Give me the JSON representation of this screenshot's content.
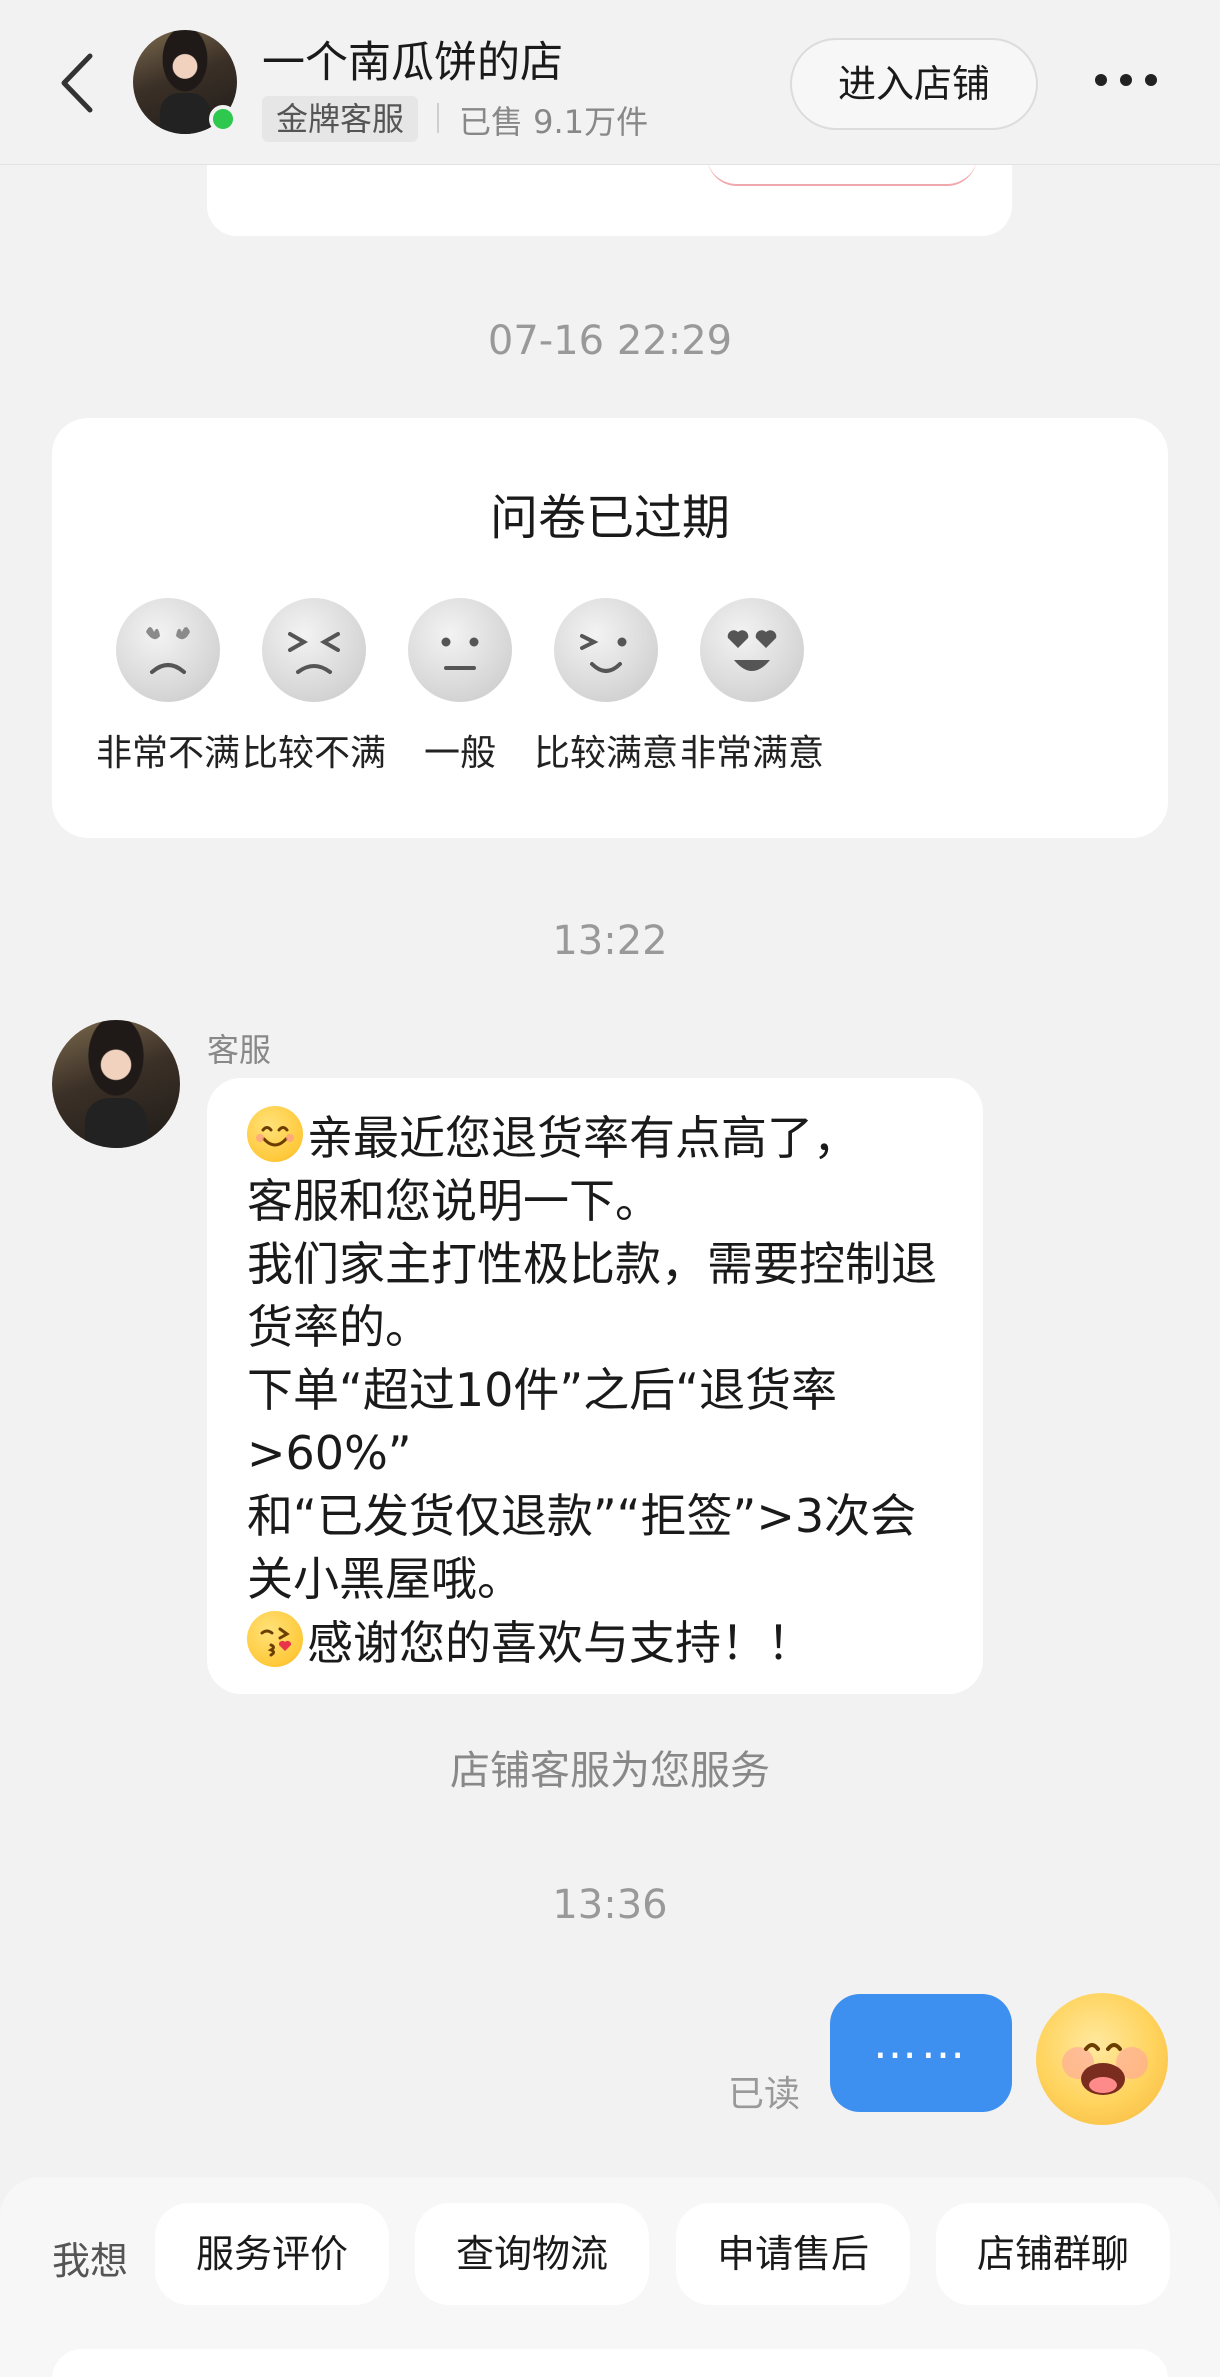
{
  "header": {
    "shop_name": "一个南瓜饼的店",
    "badge": "金牌客服",
    "sold": "已售 9.1万件",
    "enter_shop_label": "进入店铺"
  },
  "timestamps": {
    "t1": "07-16 22:29",
    "t2": "13:22",
    "t3": "13:36"
  },
  "survey": {
    "title": "问卷已过期",
    "options": [
      {
        "label": "非常不满",
        "icon": "very-dissatisfied-face-icon"
      },
      {
        "label": "比较不满",
        "icon": "dissatisfied-face-icon"
      },
      {
        "label": "一般",
        "icon": "neutral-face-icon"
      },
      {
        "label": "比较满意",
        "icon": "satisfied-face-icon"
      },
      {
        "label": "非常满意",
        "icon": "very-satisfied-face-icon"
      }
    ]
  },
  "message_in": {
    "sender": "客服",
    "line1": "亲最近您退货率有点高了，",
    "body": "客服和您说明一下。\n我们家主打性极比款，需要控制退货率的。\n下单“超过10件”之后“退货率>60%”\n和“已发货仅退款”“拒签”>3次会关小黑屋哦。",
    "last_line": "感谢您的喜欢与支持！！"
  },
  "system_notice": "店铺客服为您服务",
  "message_out": {
    "text": "……",
    "read_status": "已读"
  },
  "quick_bar": {
    "prefix": "我想",
    "buttons": [
      "服务评价",
      "查询物流",
      "申请售后",
      "店铺群聊"
    ]
  },
  "colors": {
    "background": "#f2f2f2",
    "bubble_out": "#3d8ff0",
    "online": "#2dc84d"
  }
}
